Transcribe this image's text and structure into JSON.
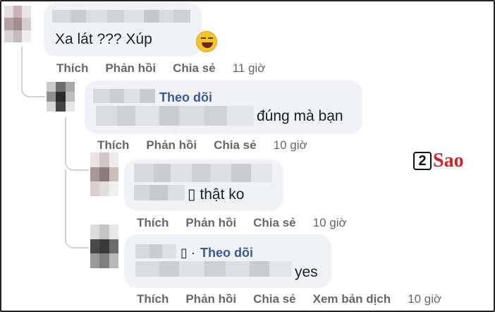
{
  "comments": [
    {
      "text": "Xa lát ??? Xúp",
      "actions": {
        "like": "Thích",
        "reply": "Phản hồi",
        "share": "Chia sẻ",
        "time": "11 giờ"
      }
    },
    {
      "follow": "Theo dõi",
      "text": "đúng mà bạn",
      "actions": {
        "like": "Thích",
        "reply": "Phản hồi",
        "share": "Chia sẻ",
        "time": "10 giờ"
      }
    },
    {
      "text": "▯ thật ko",
      "actions": {
        "like": "Thích",
        "reply": "Phản hồi",
        "share": "Chia sẻ",
        "time": "10 giờ"
      }
    },
    {
      "follow_prefix": "▯ ·",
      "follow": "Theo dõi",
      "text": "yes",
      "actions": {
        "like": "Thích",
        "reply": "Phản hồi",
        "share": "Chia sẻ",
        "translate": "Xem bản dịch",
        "time": "10 giờ"
      }
    }
  ],
  "watermark": {
    "number": "2",
    "brand": "Sao"
  },
  "colors": {
    "follow": "#3b5998",
    "brand_red": "#d4212a",
    "bubble": "#f0f2f5",
    "muted": "#65676b"
  }
}
